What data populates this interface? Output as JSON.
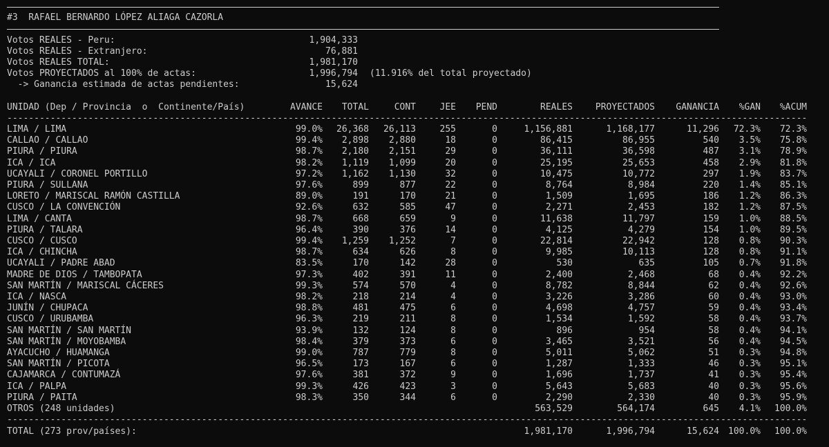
{
  "title": "#3  RAFAEL BERNARDO LÓPEZ ALIAGA CAZORLA",
  "summary": [
    {
      "label": "Votos REALES - Peru:",
      "value": "1,904,333",
      "extra": ""
    },
    {
      "label": "Votos REALES - Extranjero:",
      "value": "76,881",
      "extra": ""
    },
    {
      "label": "Votos REALES TOTAL:",
      "value": "1,981,170",
      "extra": ""
    },
    {
      "label": "Votos PROYECTADOS al 100% de actas:",
      "value": "1,996,794",
      "extra": "(11.916% del total proyectado)"
    },
    {
      "label": "  -> Ganancia estimada de actas pendientes:",
      "value": "15,624",
      "extra": ""
    }
  ],
  "columns": [
    "UNIDAD (Dep / Provincia  o  Continente/País)",
    "AVANCE",
    "TOTAL",
    "CONT",
    "JEE",
    "PEND",
    "REALES",
    "PROYECTADOS",
    "GANANCIA",
    "%GAN",
    "%ACUM"
  ],
  "rows": [
    [
      "LIMA / LIMA",
      "99.0%",
      "26,368",
      "26,113",
      "255",
      "0",
      "1,156,881",
      "1,168,177",
      "11,296",
      "72.3%",
      "72.3%"
    ],
    [
      "CALLAO / CALLAO",
      "99.4%",
      "2,898",
      "2,880",
      "18",
      "0",
      "86,415",
      "86,955",
      "540",
      "3.5%",
      "75.8%"
    ],
    [
      "PIURA / PIURA",
      "98.7%",
      "2,180",
      "2,151",
      "29",
      "0",
      "36,111",
      "36,598",
      "487",
      "3.1%",
      "78.9%"
    ],
    [
      "ICA / ICA",
      "98.2%",
      "1,119",
      "1,099",
      "20",
      "0",
      "25,195",
      "25,653",
      "458",
      "2.9%",
      "81.8%"
    ],
    [
      "UCAYALI / CORONEL PORTILLO",
      "97.2%",
      "1,162",
      "1,130",
      "32",
      "0",
      "10,475",
      "10,772",
      "297",
      "1.9%",
      "83.7%"
    ],
    [
      "PIURA / SULLANA",
      "97.6%",
      "899",
      "877",
      "22",
      "0",
      "8,764",
      "8,984",
      "220",
      "1.4%",
      "85.1%"
    ],
    [
      "LORETO / MARISCAL RAMÓN CASTILLA",
      "89.0%",
      "191",
      "170",
      "21",
      "0",
      "1,509",
      "1,695",
      "186",
      "1.2%",
      "86.3%"
    ],
    [
      "CUSCO / LA CONVENCIÓN",
      "92.6%",
      "632",
      "585",
      "47",
      "0",
      "2,271",
      "2,453",
      "182",
      "1.2%",
      "87.5%"
    ],
    [
      "LIMA / CANTA",
      "98.7%",
      "668",
      "659",
      "9",
      "0",
      "11,638",
      "11,797",
      "159",
      "1.0%",
      "88.5%"
    ],
    [
      "PIURA / TALARA",
      "96.4%",
      "390",
      "376",
      "14",
      "0",
      "4,125",
      "4,279",
      "154",
      "1.0%",
      "89.5%"
    ],
    [
      "CUSCO / CUSCO",
      "99.4%",
      "1,259",
      "1,252",
      "7",
      "0",
      "22,814",
      "22,942",
      "128",
      "0.8%",
      "90.3%"
    ],
    [
      "ICA / CHINCHA",
      "98.7%",
      "634",
      "626",
      "8",
      "0",
      "9,985",
      "10,113",
      "128",
      "0.8%",
      "91.1%"
    ],
    [
      "UCAYALI / PADRE ABAD",
      "83.5%",
      "170",
      "142",
      "28",
      "0",
      "530",
      "635",
      "105",
      "0.7%",
      "91.8%"
    ],
    [
      "MADRE DE DIOS / TAMBOPATA",
      "97.3%",
      "402",
      "391",
      "11",
      "0",
      "2,400",
      "2,468",
      "68",
      "0.4%",
      "92.2%"
    ],
    [
      "SAN MARTÍN / MARISCAL CÁCERES",
      "99.3%",
      "574",
      "570",
      "4",
      "0",
      "8,782",
      "8,844",
      "62",
      "0.4%",
      "92.6%"
    ],
    [
      "ICA / NASCA",
      "98.2%",
      "218",
      "214",
      "4",
      "0",
      "3,226",
      "3,286",
      "60",
      "0.4%",
      "93.0%"
    ],
    [
      "JUNÍN / CHUPACA",
      "98.8%",
      "481",
      "475",
      "6",
      "0",
      "4,698",
      "4,757",
      "59",
      "0.4%",
      "93.4%"
    ],
    [
      "CUSCO / URUBAMBA",
      "96.3%",
      "219",
      "211",
      "8",
      "0",
      "1,534",
      "1,592",
      "58",
      "0.4%",
      "93.7%"
    ],
    [
      "SAN MARTÍN / SAN MARTÍN",
      "93.9%",
      "132",
      "124",
      "8",
      "0",
      "896",
      "954",
      "58",
      "0.4%",
      "94.1%"
    ],
    [
      "SAN MARTÍN / MOYOBAMBA",
      "98.4%",
      "379",
      "373",
      "6",
      "0",
      "3,465",
      "3,521",
      "56",
      "0.4%",
      "94.5%"
    ],
    [
      "AYACUCHO / HUAMANGA",
      "99.0%",
      "787",
      "779",
      "8",
      "0",
      "5,011",
      "5,062",
      "51",
      "0.3%",
      "94.8%"
    ],
    [
      "SAN MARTÍN / PICOTA",
      "96.5%",
      "173",
      "167",
      "6",
      "0",
      "1,287",
      "1,333",
      "46",
      "0.3%",
      "95.1%"
    ],
    [
      "CAJAMARCA / CONTUMAZÁ",
      "97.6%",
      "381",
      "372",
      "9",
      "0",
      "1,696",
      "1,737",
      "41",
      "0.3%",
      "95.4%"
    ],
    [
      "ICA / PALPA",
      "99.3%",
      "426",
      "423",
      "3",
      "0",
      "5,643",
      "5,683",
      "40",
      "0.3%",
      "95.6%"
    ],
    [
      "PIURA / PAITA",
      "98.3%",
      "350",
      "344",
      "6",
      "0",
      "2,290",
      "2,330",
      "40",
      "0.3%",
      "95.9%"
    ],
    [
      "OTROS (248 unidades)",
      "",
      "",
      "",
      "",
      "",
      "563,529",
      "564,174",
      "645",
      "4.1%",
      "100.0%"
    ]
  ],
  "total": [
    "TOTAL (273 prov/países):",
    "",
    "",
    "",
    "",
    "",
    "1,981,170",
    "1,996,794",
    "15,624",
    "100.0%",
    "100.0%"
  ]
}
